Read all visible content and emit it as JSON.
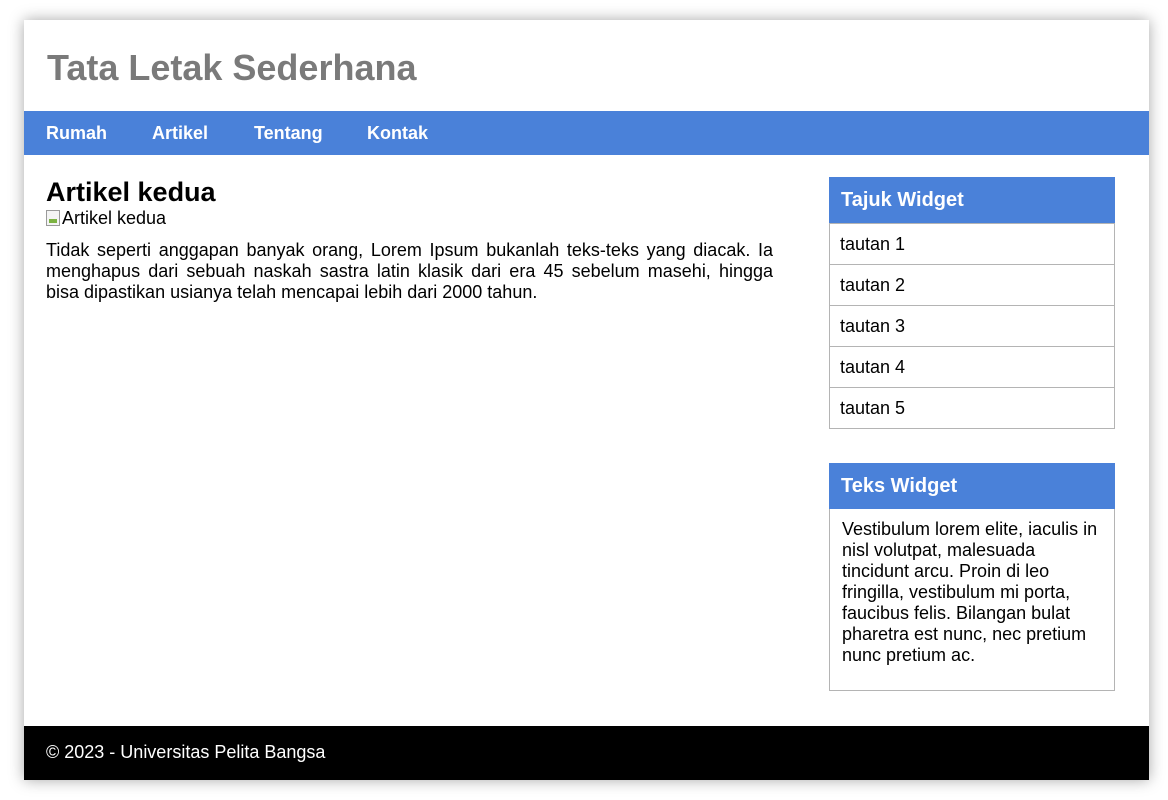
{
  "header": {
    "title": "Tata Letak Sederhana"
  },
  "nav": {
    "items": [
      {
        "label": "Rumah"
      },
      {
        "label": "Artikel"
      },
      {
        "label": "Tentang"
      },
      {
        "label": "Kontak"
      }
    ]
  },
  "article": {
    "title": "Artikel kedua",
    "image_alt": "Artikel kedua",
    "text": "Tidak seperti anggapan banyak orang, Lorem Ipsum bukanlah teks-teks yang diacak. Ia menghapus dari sebuah naskah sastra latin klasik dari era 45 sebelum masehi, hingga bisa dipastikan usianya telah mencapai lebih dari 2000 tahun."
  },
  "sidebar": {
    "links_widget": {
      "title": "Tajuk Widget",
      "links": [
        "tautan 1",
        "tautan 2",
        "tautan 3",
        "tautan 4",
        "tautan 5"
      ]
    },
    "text_widget": {
      "title": "Teks Widget",
      "body": "Vestibulum lorem elite, iaculis in nisl volutpat, malesuada tincidunt arcu. Proin di leo fringilla, vestibulum mi porta, faucibus felis. Bilangan bulat pharetra est nunc, nec pretium nunc pretium ac."
    }
  },
  "footer": {
    "text": "© 2023 - Universitas Pelita Bangsa"
  },
  "colors": {
    "accent": "#4a81d9",
    "title_gray": "#7a7a7a",
    "footer_bg": "#000000"
  }
}
